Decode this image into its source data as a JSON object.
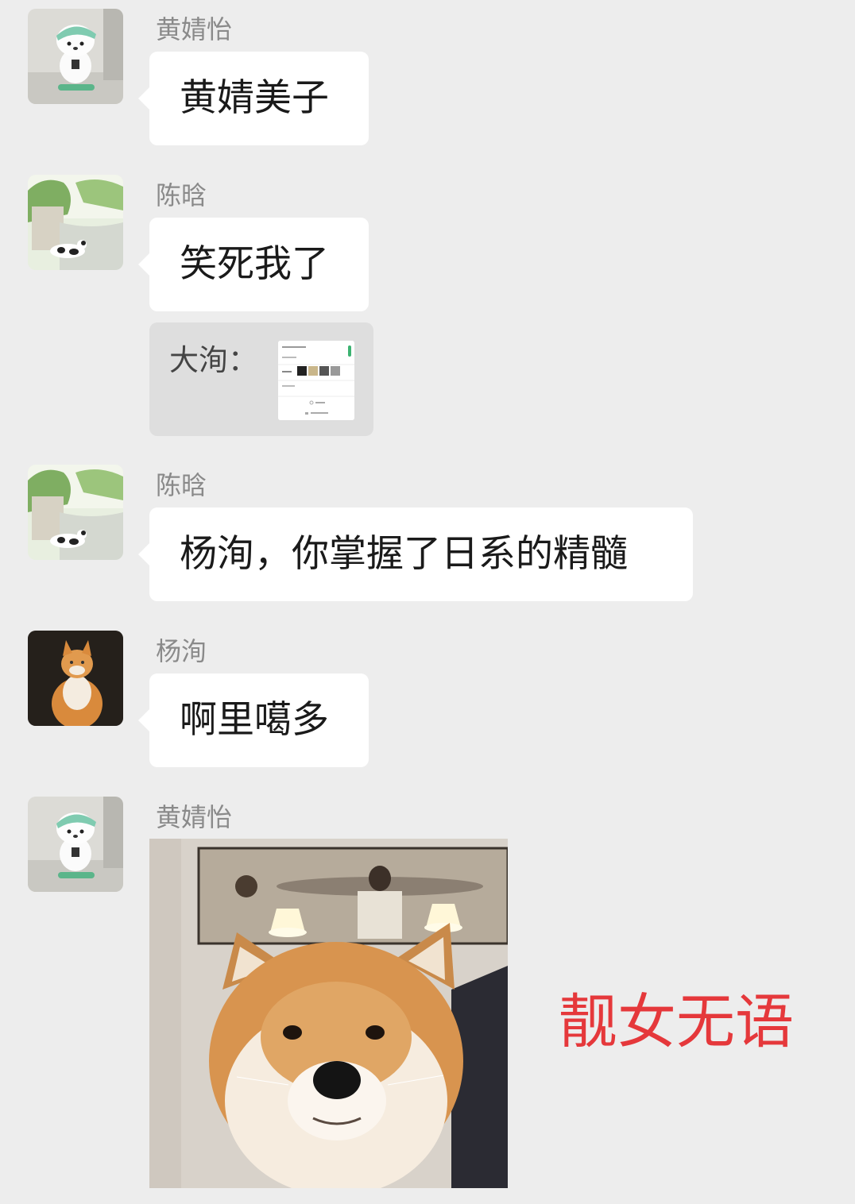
{
  "messages": [
    {
      "sender": "黄婧怡",
      "text": "黄婧美子"
    },
    {
      "sender": "陈晗",
      "text": "笑死我了"
    },
    {
      "quote_label": "大洵："
    },
    {
      "sender": "陈晗",
      "text": "杨洵，你掌握了日系的精髓"
    },
    {
      "sender": "杨洵",
      "text": "啊里噶多"
    },
    {
      "sender": "黄婧怡",
      "caption": "靓女无语"
    }
  ],
  "avatars": {
    "huang": "pochacco-avatar",
    "chen": "garden-cat-avatar",
    "yang": "orange-cat-avatar"
  },
  "colors": {
    "background": "#ededed",
    "bubble": "#ffffff",
    "quote_bg": "#dedede",
    "caption": "#e5383b"
  }
}
